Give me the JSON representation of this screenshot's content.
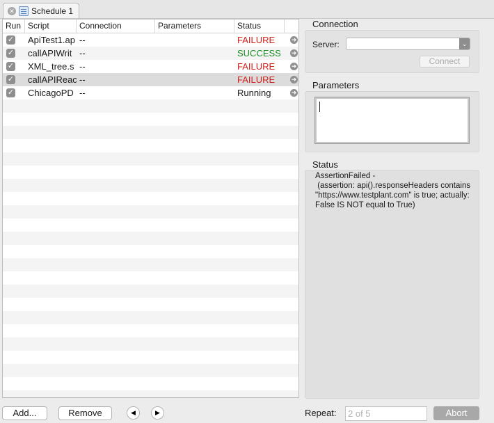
{
  "tab": {
    "label": "Schedule 1"
  },
  "table": {
    "columns": [
      "Run",
      "Script",
      "Connection",
      "Parameters",
      "Status"
    ],
    "rows": [
      {
        "script": "ApiTest1.ap",
        "connection": "--",
        "parameters": "",
        "status": "FAILURE",
        "status_kind": "failure",
        "selected": false
      },
      {
        "script": "callAPIWrit",
        "connection": "--",
        "parameters": "",
        "status": "SUCCESS",
        "status_kind": "success",
        "selected": false
      },
      {
        "script": "XML_tree.s",
        "connection": "--",
        "parameters": "",
        "status": "FAILURE",
        "status_kind": "failure",
        "selected": false
      },
      {
        "script": "callAPIReac",
        "connection": "--",
        "parameters": "",
        "status": "FAILURE",
        "status_kind": "failure",
        "selected": true
      },
      {
        "script": "ChicagoPD",
        "connection": "--",
        "parameters": "",
        "status": "Running",
        "status_kind": "running",
        "selected": false
      }
    ]
  },
  "connection": {
    "title": "Connection",
    "server_label": "Server:",
    "server_value": "",
    "connect_label": "Connect"
  },
  "parameters": {
    "title": "Parameters",
    "value": ""
  },
  "status": {
    "title": "Status",
    "text": "AssertionFailed -\n (assertion: api().responseHeaders contains \"https://www.testplant.com\" is true; actually: False IS NOT equal to True)"
  },
  "footer": {
    "add_label": "Add...",
    "remove_label": "Remove",
    "repeat_label": "Repeat:",
    "repeat_placeholder": "2 of 5",
    "abort_label": "Abort"
  },
  "colors": {
    "failure": "#d0201b",
    "success": "#1e8a25"
  }
}
